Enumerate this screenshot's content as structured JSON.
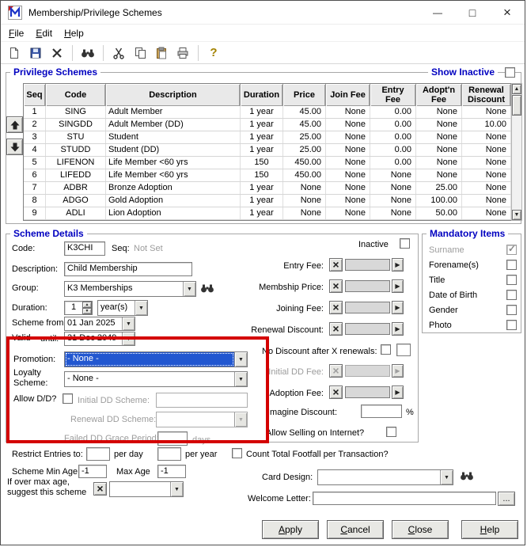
{
  "window": {
    "title": "Membership/Privilege Schemes",
    "controls": [
      "minimize",
      "maximize",
      "close"
    ]
  },
  "menu": {
    "items": [
      "File",
      "Edit",
      "Help"
    ]
  },
  "toolbar": {
    "buttons": [
      "new",
      "save",
      "delete",
      "find",
      "cut",
      "copy",
      "paste",
      "print",
      "help"
    ]
  },
  "colors": {
    "accent_blue": "#0000c0",
    "selection_blue": "#2257d0",
    "annotation_red": "#d40000"
  },
  "privilege_schemes": {
    "title": "Privilege Schemes",
    "show_inactive_label": "Show Inactive",
    "table": {
      "columns": [
        "Seq",
        "Code",
        "Description",
        "Duration",
        "Price",
        "Join Fee",
        "Entry\nFee",
        "Adopt'n\nFee",
        "Renewal\nDiscount"
      ],
      "rows": [
        [
          "1",
          "SING",
          "Adult Member",
          "1 year",
          "45.00",
          "None",
          "0.00",
          "None",
          "None"
        ],
        [
          "2",
          "SINGDD",
          "Adult Member (DD)",
          "1 year",
          "45.00",
          "None",
          "0.00",
          "None",
          "10.00"
        ],
        [
          "3",
          "STU",
          "Student",
          "1 year",
          "25.00",
          "None",
          "0.00",
          "None",
          "None"
        ],
        [
          "4",
          "STUDD",
          "Student (DD)",
          "1 year",
          "25.00",
          "None",
          "0.00",
          "None",
          "None"
        ],
        [
          "5",
          "LIFENON",
          "Life Member <60 yrs",
          "150",
          "450.00",
          "None",
          "0.00",
          "None",
          "None"
        ],
        [
          "6",
          "LIFEDD",
          "Life Member <60 yrs",
          "150",
          "450.00",
          "None",
          "None",
          "None",
          "None"
        ],
        [
          "7",
          "ADBR",
          "Bronze Adoption",
          "1 year",
          "None",
          "None",
          "None",
          "25.00",
          "None"
        ],
        [
          "8",
          "ADGO",
          "Gold Adoption",
          "1 year",
          "None",
          "None",
          "None",
          "100.00",
          "None"
        ],
        [
          "9",
          "ADLI",
          "Lion Adoption",
          "1 year",
          "None",
          "None",
          "None",
          "50.00",
          "None"
        ]
      ]
    }
  },
  "scheme_details": {
    "title": "Scheme Details",
    "code_label": "Code:",
    "code_value": "K3CHI",
    "seq_label": "Seq:",
    "seq_value": "Not Set",
    "description_label": "Description:",
    "description_value": "Child Membership",
    "group_label": "Group:",
    "group_value": "K3 Memberships",
    "duration_label": "Duration:",
    "duration_value": "1",
    "duration_unit": "year(s)",
    "scheme_from_label": "Scheme from",
    "valid_label": "Valid",
    "until_label": "until:",
    "scheme_from_value": "01 Jan 2025",
    "until_value": "31 Dec 2049",
    "promotion_label": "Promotion:",
    "promotion_value": "- None -",
    "loyalty_label_line1": "Loyalty",
    "loyalty_label_line2": "Scheme:",
    "loyalty_value": "- None -",
    "allow_dd_label": "Allow D/D?",
    "initial_dd_scheme_label": "Initial DD Scheme:",
    "renewal_dd_scheme_label": "Renewal DD Scheme:",
    "failed_dd_label": "Failed DD Grace Period:",
    "days_label": "days",
    "inactive_label": "Inactive",
    "entry_fee_label": "Entry Fee:",
    "membship_price_label": "Membship Price:",
    "joining_fee_label": "Joining Fee:",
    "renewal_discount_label": "Renewal Discount:",
    "no_discount_label": "No Discount after X renewals:",
    "initial_dd_fee_label": "Initial DD Fee:",
    "adoption_fee_label": "Adoption Fee:",
    "imagine_discount_label": "Imagine Discount:",
    "percent_label": "%",
    "allow_selling_label": "Allow Selling on Internet?"
  },
  "mandatory_items": {
    "title": "Mandatory Items",
    "items": [
      {
        "label": "Surname",
        "checked": true,
        "disabled": true
      },
      {
        "label": "Forename(s)",
        "checked": false,
        "disabled": false
      },
      {
        "label": "Title",
        "checked": false,
        "disabled": false
      },
      {
        "label": "Date of Birth",
        "checked": false,
        "disabled": false
      },
      {
        "label": "Gender",
        "checked": false,
        "disabled": false
      },
      {
        "label": "Photo",
        "checked": false,
        "disabled": false
      }
    ]
  },
  "bottom": {
    "restrict_label": "Restrict Entries to:",
    "per_day_label": "per day",
    "per_year_label": "per year",
    "footfall_label": "Count Total Footfall per Transaction?",
    "min_age_label": "Scheme Min Age",
    "min_age_value": "-1",
    "max_age_label": "Max Age",
    "max_age_value": "-1",
    "card_design_label": "Card Design:",
    "over_max_line1": "If over max age,",
    "over_max_line2": "suggest this scheme",
    "welcome_letter_label": "Welcome Letter:",
    "browse_label": "..."
  },
  "buttons": {
    "apply": "Apply",
    "cancel": "Cancel",
    "close": "Close",
    "help": "Help"
  }
}
